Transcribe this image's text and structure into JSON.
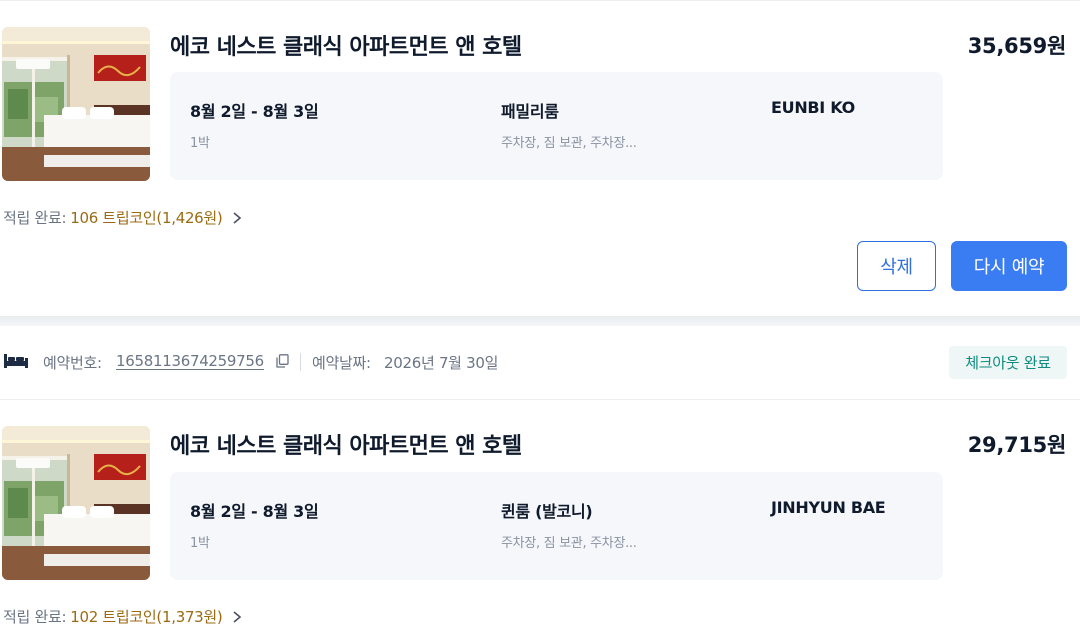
{
  "bookings": [
    {
      "hotel_name": "에코 네스트 클래식 아파트먼트 앤 호텔",
      "price": "35,659원",
      "dates": "8월 2일 - 8월 3일",
      "nights": "1박",
      "room_type": "패밀리룸",
      "amenities": "주차장, 짐 보관, 주차장...",
      "guest_name": "EUNBI KO",
      "coin_label": "적립 완료:",
      "coin_value": "106 트립코인(1,426원)",
      "delete_label": "삭제",
      "rebook_label": "다시 예약"
    },
    {
      "booking_no_label": "예약번호:",
      "booking_no": "1658113674259756",
      "booking_date_label": "예약날짜:",
      "booking_date": "2026년 7월 30일",
      "status": "체크아웃 완료",
      "hotel_name": "에코 네스트 클래식 아파트먼트 앤 호텔",
      "price": "29,715원",
      "dates": "8월 2일 - 8월 3일",
      "nights": "1박",
      "room_type": "퀸룸 (발코니)",
      "amenities": "주차장, 짐 보관, 주차장...",
      "guest_name": "JINHYUN BAE",
      "coin_label": "적립 완료:",
      "coin_value": "102 트립코인(1,373원)"
    }
  ],
  "colors": {
    "accent": "#3a7cf2",
    "coin": "#9b6b13",
    "status": "#0e8b7e"
  },
  "icons": [
    "hotel-room-photo",
    "chevron-right-icon",
    "bed-icon",
    "copy-icon"
  ]
}
